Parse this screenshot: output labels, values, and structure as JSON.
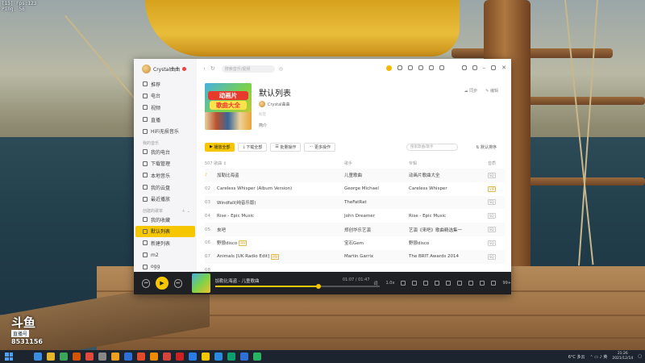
{
  "overlay": {
    "fps_line1": "[15] Fps:123",
    "fps_line2": "Ping: 56"
  },
  "douyu": {
    "logo": "斗鱼",
    "sub": "直播号",
    "room_id": "8531156"
  },
  "app": {
    "user": {
      "name": "Crystal曲曲"
    },
    "sidebar": {
      "top_items": [
        {
          "label": "推荐",
          "icon": "home-icon"
        },
        {
          "label": "电台",
          "icon": "radio-icon"
        },
        {
          "label": "视频",
          "icon": "video-icon"
        },
        {
          "label": "直播",
          "icon": "live-icon"
        },
        {
          "label": "HiFi无损音乐",
          "icon": "hifi-icon"
        }
      ],
      "my_music_label": "我的音乐",
      "my_items": [
        {
          "label": "我的电台",
          "icon": "radio-icon"
        },
        {
          "label": "下载管理",
          "icon": "download-icon"
        },
        {
          "label": "本地音乐",
          "icon": "local-music-icon"
        },
        {
          "label": "我的云盘",
          "icon": "cloud-icon"
        },
        {
          "label": "最近播放",
          "icon": "recent-icon"
        }
      ],
      "created_label": "创建的歌单",
      "playlists": [
        {
          "label": "我的收藏",
          "icon": "heart-icon",
          "active": false
        },
        {
          "label": "默认列表",
          "icon": "list-icon",
          "active": true
        },
        {
          "label": "新建列表",
          "icon": "list-icon",
          "active": false
        },
        {
          "label": "m2",
          "icon": "list-icon",
          "active": false
        },
        {
          "label": "ogg",
          "icon": "list-icon",
          "active": false
        }
      ]
    },
    "toolbar": {
      "search_placeholder": "搜索音乐/视频"
    },
    "playlist": {
      "title": "默认列表",
      "owner": "Crystal曲曲",
      "tag": "标签",
      "desc": "简介",
      "cover_line1": "动画片",
      "cover_line2": "歌曲大全",
      "sync_label": "同步",
      "edit_label": "编辑"
    },
    "actions": {
      "play_all": "播放全部",
      "download_all": "下载全部",
      "batch": "批量操作",
      "more": "更多操作",
      "search_placeholder": "搜索歌曲/歌手",
      "sort": "默认排序"
    },
    "table": {
      "headers": {
        "title": "507  歌曲  ↕",
        "artist": "歌手",
        "album": "专辑",
        "quality": "音质"
      },
      "rows": [
        {
          "no": "♪",
          "title": "加勒比海盗",
          "artist": "儿童歌曲",
          "album": "动画片歌曲大全",
          "q": "SQ",
          "mv": "",
          "playing": true
        },
        {
          "no": "02",
          "title": "Careless Whisper (Album Version)",
          "artist": "George Michael",
          "album": "Careless Whisper",
          "q": "VIP",
          "mv": "",
          "playing": false
        },
        {
          "no": "03",
          "title": "Windfall(纯音乐版)",
          "artist": "TheFatRat",
          "album": "",
          "q": "SQ",
          "mv": "",
          "playing": false
        },
        {
          "no": "04",
          "title": "Rise - Epic Music",
          "artist": "John Dreamer",
          "album": "Rise - Epic Music",
          "q": "SQ",
          "mv": "",
          "playing": false
        },
        {
          "no": "05",
          "title": "來吧",
          "artist": "郑创华乐艺演",
          "album": "艺演《来吧》歌曲精选集一",
          "q": "SQ",
          "mv": "",
          "playing": false
        },
        {
          "no": "06",
          "title": "野狼disco",
          "artist": "宝石Gem",
          "album": "野狼disco",
          "q": "SQ",
          "mv": "MV",
          "playing": false
        },
        {
          "no": "07",
          "title": "Animals [UK Radio Edit]",
          "artist": "Martin Garrix",
          "album": "The BRIT Awards 2014",
          "q": "SQ",
          "mv": "MV",
          "playing": false
        },
        {
          "no": "08",
          "title": "",
          "artist": "",
          "album": "",
          "q": "",
          "mv": "",
          "playing": false
        }
      ]
    },
    "player": {
      "now_playing": "加勒比海盗 - 儿童歌曲",
      "time": "01:07 / 01:47",
      "progress": 0.63,
      "lyric_label": "词",
      "speed": "1.0x",
      "volume_label": "99+"
    }
  },
  "taskbar": {
    "weather": "6°C 多云",
    "time": "21:26",
    "date": "2021/12/14",
    "apps": [
      "#3a8de0",
      "#e5b52b",
      "#3ba55c",
      "#d35400",
      "#e04a3c",
      "#888888",
      "#f0a020",
      "#2f6fd8",
      "#e24b2a",
      "#f08a00",
      "#d5443a",
      "#cc2222",
      "#2c7be5",
      "#f6c700",
      "#2a8ae0",
      "#0e9f6e",
      "#2f6fd8",
      "#28b463"
    ]
  },
  "colors": {
    "accent": "#f6c700",
    "player_bg": "#1f2024"
  }
}
